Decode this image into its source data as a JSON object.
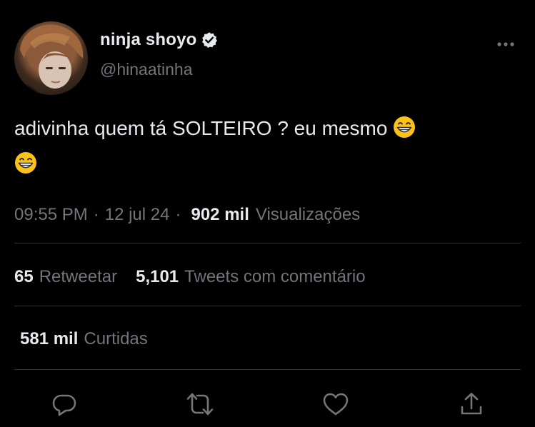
{
  "user": {
    "display_name": "ninja shoyo",
    "handle": "@hinaatinha",
    "verified_icon": "verified-badge-icon"
  },
  "tweet": {
    "text": "adivinha quem tá SOLTEIRO ? eu mesmo",
    "emoji": "grinning-face-with-smiling-eyes"
  },
  "meta": {
    "time": "09:55 PM",
    "date": "12 jul 24",
    "views_count": "902 mil",
    "views_label": "Visualizações"
  },
  "stats": {
    "retweets_count": "65",
    "retweets_label": "Retweetar",
    "quotes_count": "5,101",
    "quotes_label": "Tweets com comentário",
    "likes_count": "581 mil",
    "likes_label": "Curtidas"
  },
  "actions": [
    "reply-icon",
    "retweet-icon",
    "like-icon",
    "share-icon"
  ],
  "colors": {
    "background": "#000000",
    "primary_text": "#e7e9ea",
    "secondary_text": "#71767b",
    "divider": "#2f3336"
  }
}
